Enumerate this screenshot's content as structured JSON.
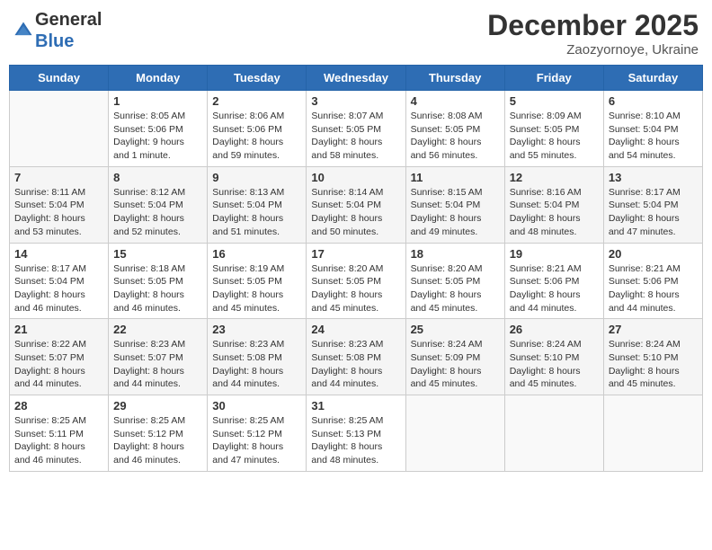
{
  "logo": {
    "general": "General",
    "blue": "Blue"
  },
  "header": {
    "month": "December 2025",
    "location": "Zaozyornoye, Ukraine"
  },
  "weekdays": [
    "Sunday",
    "Monday",
    "Tuesday",
    "Wednesday",
    "Thursday",
    "Friday",
    "Saturday"
  ],
  "weeks": [
    [
      {
        "day": "",
        "info": ""
      },
      {
        "day": "1",
        "info": "Sunrise: 8:05 AM\nSunset: 5:06 PM\nDaylight: 9 hours\nand 1 minute."
      },
      {
        "day": "2",
        "info": "Sunrise: 8:06 AM\nSunset: 5:06 PM\nDaylight: 8 hours\nand 59 minutes."
      },
      {
        "day": "3",
        "info": "Sunrise: 8:07 AM\nSunset: 5:05 PM\nDaylight: 8 hours\nand 58 minutes."
      },
      {
        "day": "4",
        "info": "Sunrise: 8:08 AM\nSunset: 5:05 PM\nDaylight: 8 hours\nand 56 minutes."
      },
      {
        "day": "5",
        "info": "Sunrise: 8:09 AM\nSunset: 5:05 PM\nDaylight: 8 hours\nand 55 minutes."
      },
      {
        "day": "6",
        "info": "Sunrise: 8:10 AM\nSunset: 5:04 PM\nDaylight: 8 hours\nand 54 minutes."
      }
    ],
    [
      {
        "day": "7",
        "info": "Sunrise: 8:11 AM\nSunset: 5:04 PM\nDaylight: 8 hours\nand 53 minutes."
      },
      {
        "day": "8",
        "info": "Sunrise: 8:12 AM\nSunset: 5:04 PM\nDaylight: 8 hours\nand 52 minutes."
      },
      {
        "day": "9",
        "info": "Sunrise: 8:13 AM\nSunset: 5:04 PM\nDaylight: 8 hours\nand 51 minutes."
      },
      {
        "day": "10",
        "info": "Sunrise: 8:14 AM\nSunset: 5:04 PM\nDaylight: 8 hours\nand 50 minutes."
      },
      {
        "day": "11",
        "info": "Sunrise: 8:15 AM\nSunset: 5:04 PM\nDaylight: 8 hours\nand 49 minutes."
      },
      {
        "day": "12",
        "info": "Sunrise: 8:16 AM\nSunset: 5:04 PM\nDaylight: 8 hours\nand 48 minutes."
      },
      {
        "day": "13",
        "info": "Sunrise: 8:17 AM\nSunset: 5:04 PM\nDaylight: 8 hours\nand 47 minutes."
      }
    ],
    [
      {
        "day": "14",
        "info": "Sunrise: 8:17 AM\nSunset: 5:04 PM\nDaylight: 8 hours\nand 46 minutes."
      },
      {
        "day": "15",
        "info": "Sunrise: 8:18 AM\nSunset: 5:05 PM\nDaylight: 8 hours\nand 46 minutes."
      },
      {
        "day": "16",
        "info": "Sunrise: 8:19 AM\nSunset: 5:05 PM\nDaylight: 8 hours\nand 45 minutes."
      },
      {
        "day": "17",
        "info": "Sunrise: 8:20 AM\nSunset: 5:05 PM\nDaylight: 8 hours\nand 45 minutes."
      },
      {
        "day": "18",
        "info": "Sunrise: 8:20 AM\nSunset: 5:05 PM\nDaylight: 8 hours\nand 45 minutes."
      },
      {
        "day": "19",
        "info": "Sunrise: 8:21 AM\nSunset: 5:06 PM\nDaylight: 8 hours\nand 44 minutes."
      },
      {
        "day": "20",
        "info": "Sunrise: 8:21 AM\nSunset: 5:06 PM\nDaylight: 8 hours\nand 44 minutes."
      }
    ],
    [
      {
        "day": "21",
        "info": "Sunrise: 8:22 AM\nSunset: 5:07 PM\nDaylight: 8 hours\nand 44 minutes."
      },
      {
        "day": "22",
        "info": "Sunrise: 8:23 AM\nSunset: 5:07 PM\nDaylight: 8 hours\nand 44 minutes."
      },
      {
        "day": "23",
        "info": "Sunrise: 8:23 AM\nSunset: 5:08 PM\nDaylight: 8 hours\nand 44 minutes."
      },
      {
        "day": "24",
        "info": "Sunrise: 8:23 AM\nSunset: 5:08 PM\nDaylight: 8 hours\nand 44 minutes."
      },
      {
        "day": "25",
        "info": "Sunrise: 8:24 AM\nSunset: 5:09 PM\nDaylight: 8 hours\nand 45 minutes."
      },
      {
        "day": "26",
        "info": "Sunrise: 8:24 AM\nSunset: 5:10 PM\nDaylight: 8 hours\nand 45 minutes."
      },
      {
        "day": "27",
        "info": "Sunrise: 8:24 AM\nSunset: 5:10 PM\nDaylight: 8 hours\nand 45 minutes."
      }
    ],
    [
      {
        "day": "28",
        "info": "Sunrise: 8:25 AM\nSunset: 5:11 PM\nDaylight: 8 hours\nand 46 minutes."
      },
      {
        "day": "29",
        "info": "Sunrise: 8:25 AM\nSunset: 5:12 PM\nDaylight: 8 hours\nand 46 minutes."
      },
      {
        "day": "30",
        "info": "Sunrise: 8:25 AM\nSunset: 5:12 PM\nDaylight: 8 hours\nand 47 minutes."
      },
      {
        "day": "31",
        "info": "Sunrise: 8:25 AM\nSunset: 5:13 PM\nDaylight: 8 hours\nand 48 minutes."
      },
      {
        "day": "",
        "info": ""
      },
      {
        "day": "",
        "info": ""
      },
      {
        "day": "",
        "info": ""
      }
    ]
  ]
}
